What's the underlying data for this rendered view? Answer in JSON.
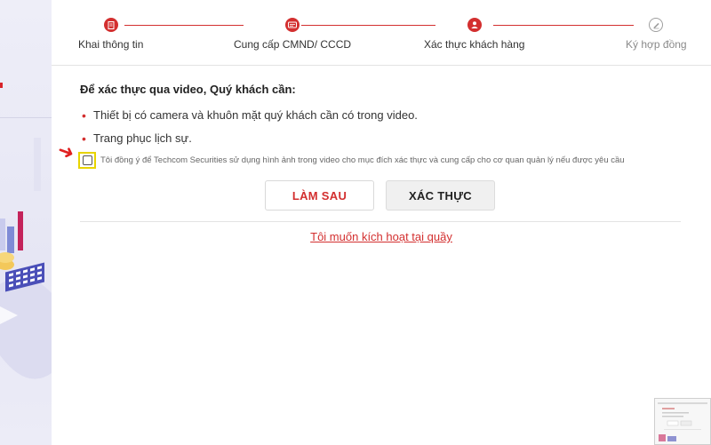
{
  "steps": [
    {
      "label": "Khai thông tin",
      "icon": "form-icon",
      "state": "done"
    },
    {
      "label": "Cung cấp CMND/ CCCD",
      "icon": "id-card-icon",
      "state": "done"
    },
    {
      "label": "Xác thực khách hàng",
      "icon": "user-icon",
      "state": "active"
    },
    {
      "label": "Ký hợp đồng",
      "icon": "pen-icon",
      "state": "pending"
    }
  ],
  "content": {
    "heading": "Để xác thực qua video, Quý khách cần:",
    "requirements": [
      "Thiết bị có camera và khuôn mặt quý khách cần có trong video.",
      "Trang phục lịch sự."
    ],
    "bullet": "•",
    "consent": "Tôi đồng ý để Techcom Securities sử dụng hình ảnh trong video cho mục đích xác thực và cung cấp cho cơ quan quản lý nếu được yêu cầu",
    "consent_checked": false
  },
  "buttons": {
    "later": "LÀM SAU",
    "verify": "XÁC THỰC"
  },
  "link": {
    "counter": "Tôi muốn kích hoạt tại quầy"
  },
  "annotation": {
    "arrow": "➜"
  },
  "colors": {
    "accent": "#d32f2f",
    "highlight": "#e8d400",
    "pending": "#9e9e9e"
  }
}
